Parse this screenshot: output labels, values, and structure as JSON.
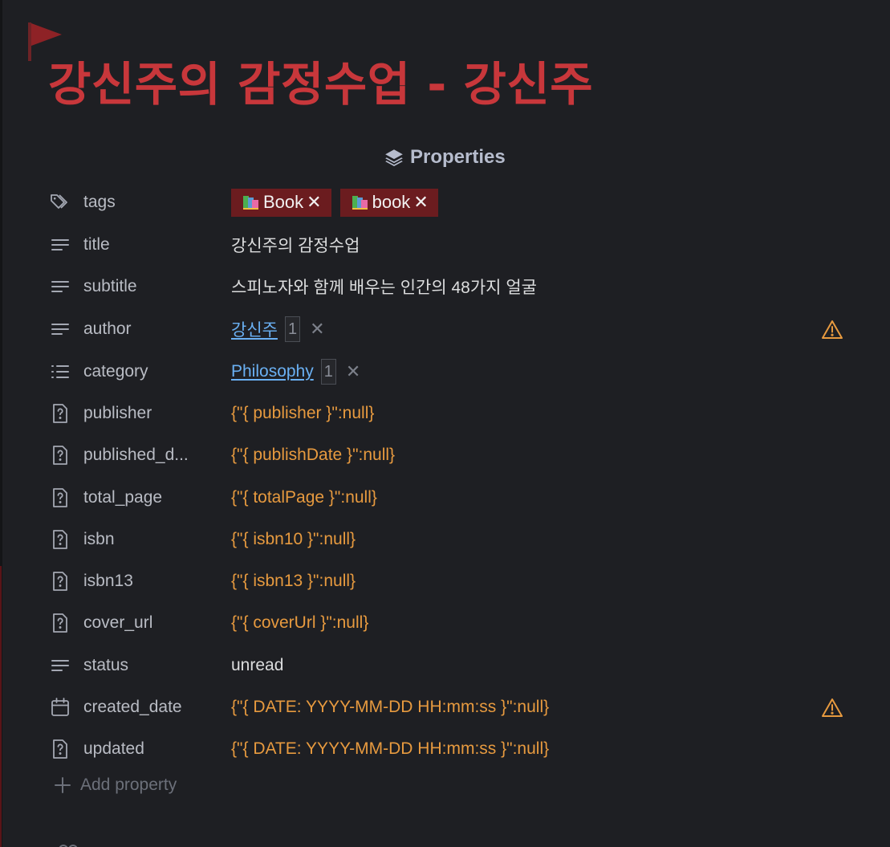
{
  "title": "강신주의 감정수업 - 강신주",
  "properties_header": "Properties",
  "tags": [
    {
      "label": "Book",
      "remove": "✕"
    },
    {
      "label": "book",
      "remove": "✕"
    }
  ],
  "rows": {
    "tags": {
      "key": "tags"
    },
    "title": {
      "key": "title",
      "value": "강신주의 감정수업"
    },
    "subtitle": {
      "key": "subtitle",
      "value": "스피노자와 함께 배우는 인간의 48가지 얼굴"
    },
    "author": {
      "key": "author",
      "value": "강신주",
      "count": "1",
      "remove": "✕"
    },
    "category": {
      "key": "category",
      "value": "Philosophy",
      "count": "1",
      "remove": "✕"
    },
    "publisher": {
      "key": "publisher",
      "value": "{\"{ publisher }\":null}"
    },
    "published_date": {
      "key": "published_d...",
      "value": "{\"{ publishDate }\":null}"
    },
    "total_page": {
      "key": "total_page",
      "value": "{\"{ totalPage }\":null}"
    },
    "isbn": {
      "key": "isbn",
      "value": "{\"{ isbn10 }\":null}"
    },
    "isbn13": {
      "key": "isbn13",
      "value": "{\"{ isbn13 }\":null}"
    },
    "cover_url": {
      "key": "cover_url",
      "value": "{\"{ coverUrl }\":null}"
    },
    "status": {
      "key": "status",
      "value": "unread"
    },
    "created_date": {
      "key": "created_date",
      "value": "{\"{ DATE: YYYY-MM-DD HH:mm:ss }\":null}"
    },
    "updated": {
      "key": "updated",
      "value": "{\"{ DATE: YYYY-MM-DD HH:mm:ss }\":null}"
    }
  },
  "add_property": "Add property",
  "icons": {
    "flag": "flag-icon",
    "properties": "layers-icon",
    "tags": "tags-icon",
    "text": "text-lines-icon",
    "list": "list-icon",
    "unknown": "file-question-icon",
    "date": "calendar-icon",
    "warning": "warning-icon",
    "add": "plus-icon"
  },
  "colors": {
    "title": "#c8373b",
    "tag_bg": "#6b1c1f",
    "template_value": "#e79a3f",
    "link": "#6ab0f3",
    "warning": "#e79a3f"
  }
}
